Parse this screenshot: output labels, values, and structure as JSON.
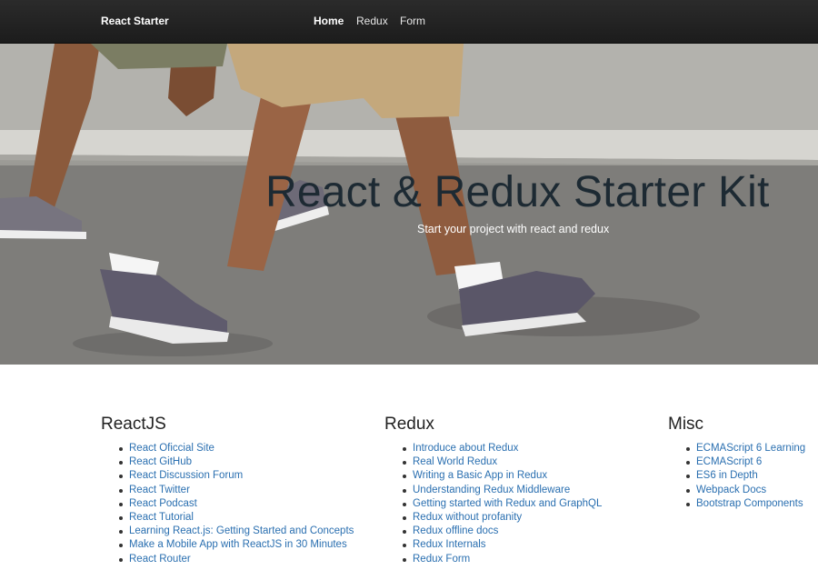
{
  "navbar": {
    "brand": "React Starter",
    "links": [
      {
        "label": "Home",
        "active": true
      },
      {
        "label": "Redux",
        "active": false
      },
      {
        "label": "Form",
        "active": false
      }
    ]
  },
  "hero": {
    "title": "React & Redux Starter Kit",
    "subtitle": "Start your project with react and redux"
  },
  "columns": [
    {
      "heading": "ReactJS",
      "links": [
        "React Oficcial Site",
        "React GitHub",
        "React Discussion Forum",
        "React Twitter",
        "React Podcast",
        "React Tutorial",
        "Learning React.js: Getting Started and Concepts",
        "Make a Mobile App with ReactJS in 30 Minutes",
        "React Router"
      ]
    },
    {
      "heading": "Redux",
      "links": [
        "Introduce about Redux",
        "Real World Redux",
        "Writing a Basic App in Redux",
        "Understanding Redux Middleware",
        "Getting started with Redux and GraphQL",
        "Redux without profanity",
        "Redux offline docs",
        "Redux Internals",
        "Redux Form"
      ]
    },
    {
      "heading": "Misc",
      "links": [
        "ECMAScript 6 Learning",
        "ECMAScript 6",
        "ES6 in Depth",
        "Webpack Docs",
        "Bootstrap Components"
      ]
    }
  ],
  "colors": {
    "navbar_bg": "#222222",
    "link": "#2a6fb0",
    "hero_title": "#1d2a33"
  }
}
